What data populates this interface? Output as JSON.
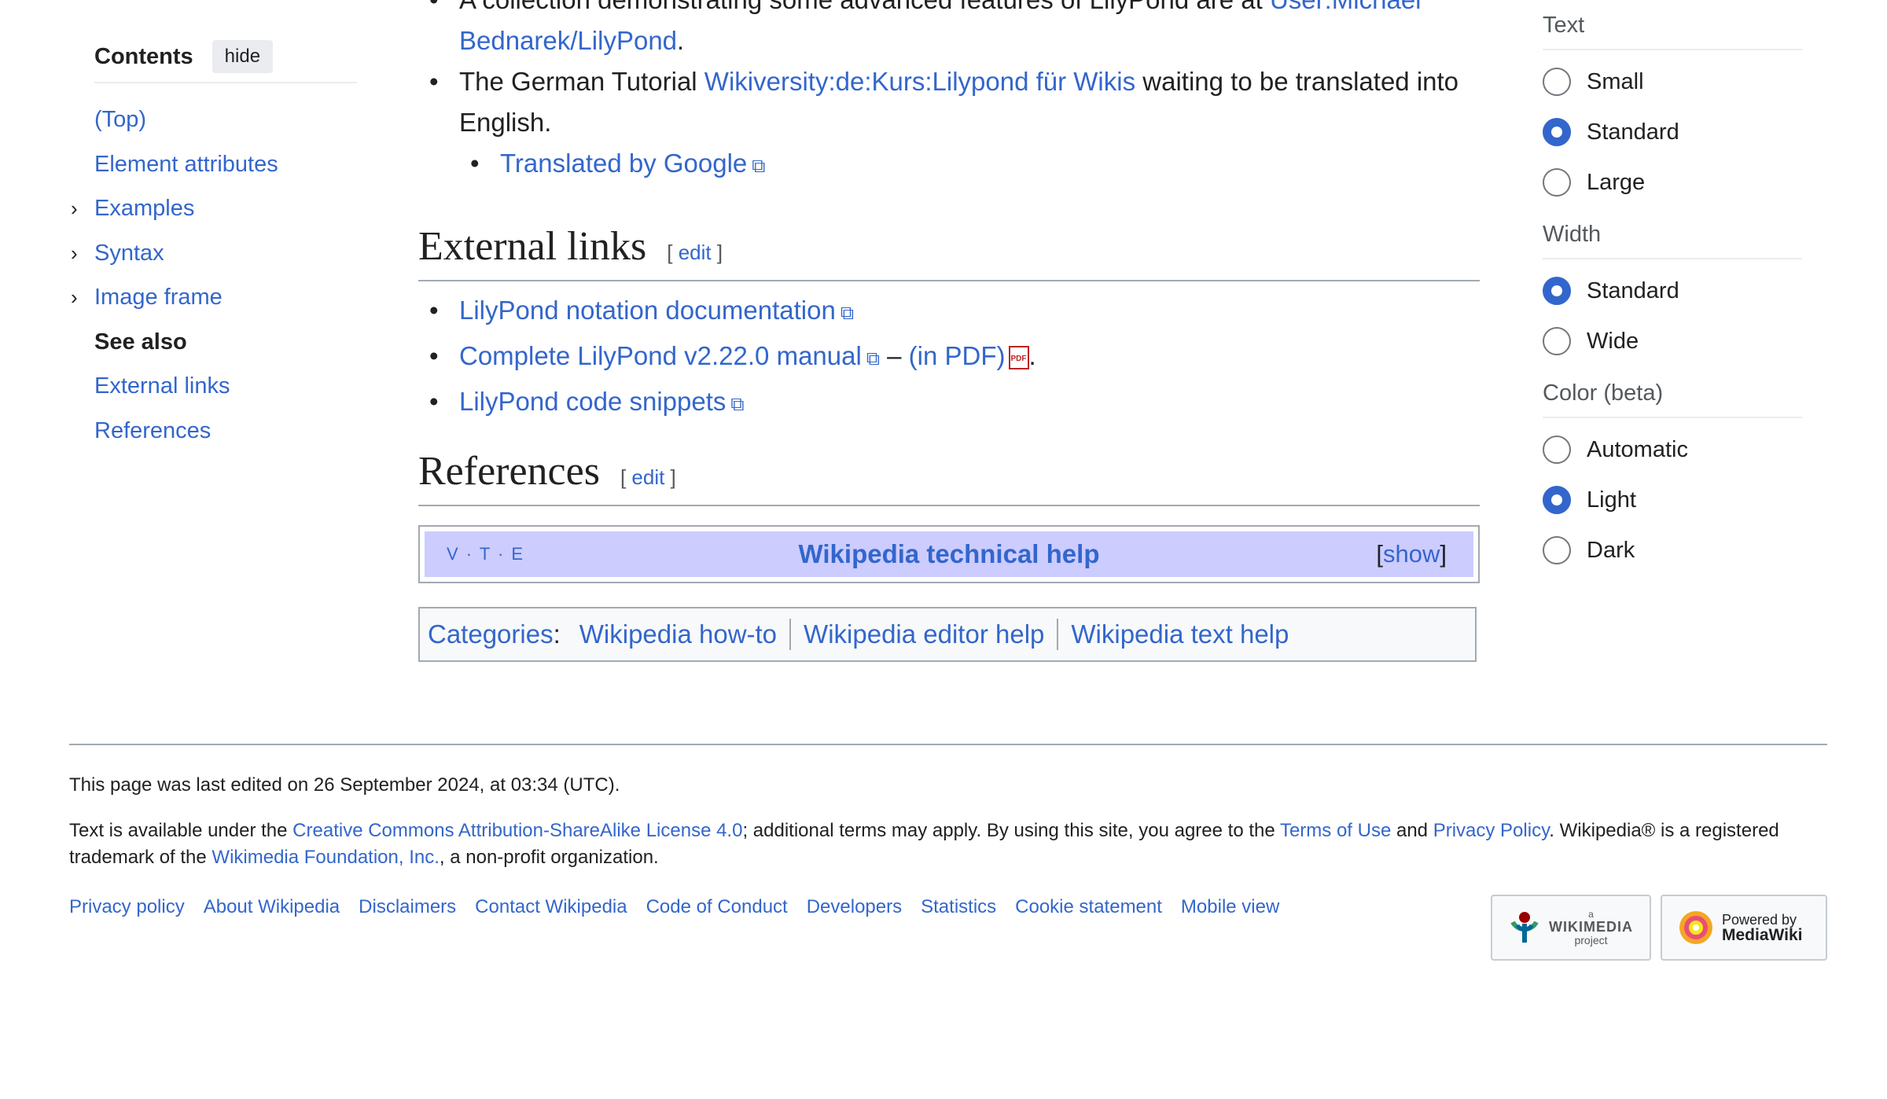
{
  "toc": {
    "title": "Contents",
    "hide": "hide",
    "items": [
      {
        "label": "(Top)"
      },
      {
        "label": "Element attributes"
      },
      {
        "label": "Examples"
      },
      {
        "label": "Syntax"
      },
      {
        "label": "Image frame"
      },
      {
        "label": "See also"
      },
      {
        "label": "External links"
      },
      {
        "label": "References"
      }
    ]
  },
  "see_also": {
    "item1_text": "A collection demonstrating some advanced features of LilyPond are at",
    "item1_link": "User:Michael Bednarek/LilyPond",
    "item2_text": "The German Tutorial",
    "item2_link": "Wikiversity:de:Kurs:Lilypond für Wikis",
    "item2_after": "waiting to be translated into English.",
    "sub_link": "Translated by Google"
  },
  "external_links": {
    "heading": "External links",
    "edit": "edit",
    "items": {
      "notation": "LilyPond notation documentation",
      "manual": "Complete LilyPond v2.22.0 manual",
      "dash": "–",
      "pdf": "(in PDF)",
      "snippets": "LilyPond code snippets"
    }
  },
  "references": {
    "heading": "References",
    "edit": "edit"
  },
  "navbox": {
    "vte": "V · T · E",
    "title": "Wikipedia technical help",
    "show": "show"
  },
  "categories": {
    "label": "Categories",
    "items": [
      "Wikipedia how-to",
      "Wikipedia editor help",
      "Wikipedia text help"
    ]
  },
  "appearance": {
    "text_heading": "Text",
    "text_options": [
      "Small",
      "Standard",
      "Large"
    ],
    "width_heading": "Width",
    "width_options": [
      "Standard",
      "Wide"
    ],
    "color_heading": "Color (beta)",
    "color_options": [
      "Automatic",
      "Light",
      "Dark"
    ]
  },
  "footer": {
    "edited": "This page was last edited on 26 September 2024, at 03:34 (UTC).",
    "lic_1": "Text is available under the",
    "lic_link": "Creative Commons Attribution-ShareAlike License 4.0",
    "lic_2": "; additional terms may apply. By using this site, you agree to the",
    "terms": "Terms of Use",
    "and": "and",
    "privacy": "Privacy Policy",
    "lic_3": ". Wikipedia® is a registered trademark of the",
    "wmf": "Wikimedia Foundation, Inc.",
    "lic_4": ", a non-profit organization.",
    "links": [
      "Privacy policy",
      "About Wikipedia",
      "Disclaimers",
      "Contact Wikipedia",
      "Code of Conduct",
      "Developers",
      "Statistics",
      "Cookie statement",
      "Mobile view"
    ],
    "badge_wm_small": "a",
    "badge_wm_big": "WIKIMEDIA",
    "badge_wm_sub": "project",
    "badge_mw_1": "Powered by",
    "badge_mw_2": "MediaWiki"
  },
  "colors": {
    "link": "#3366cc",
    "navbox_bg": "#ccccff",
    "border": "#a2a9b1"
  }
}
